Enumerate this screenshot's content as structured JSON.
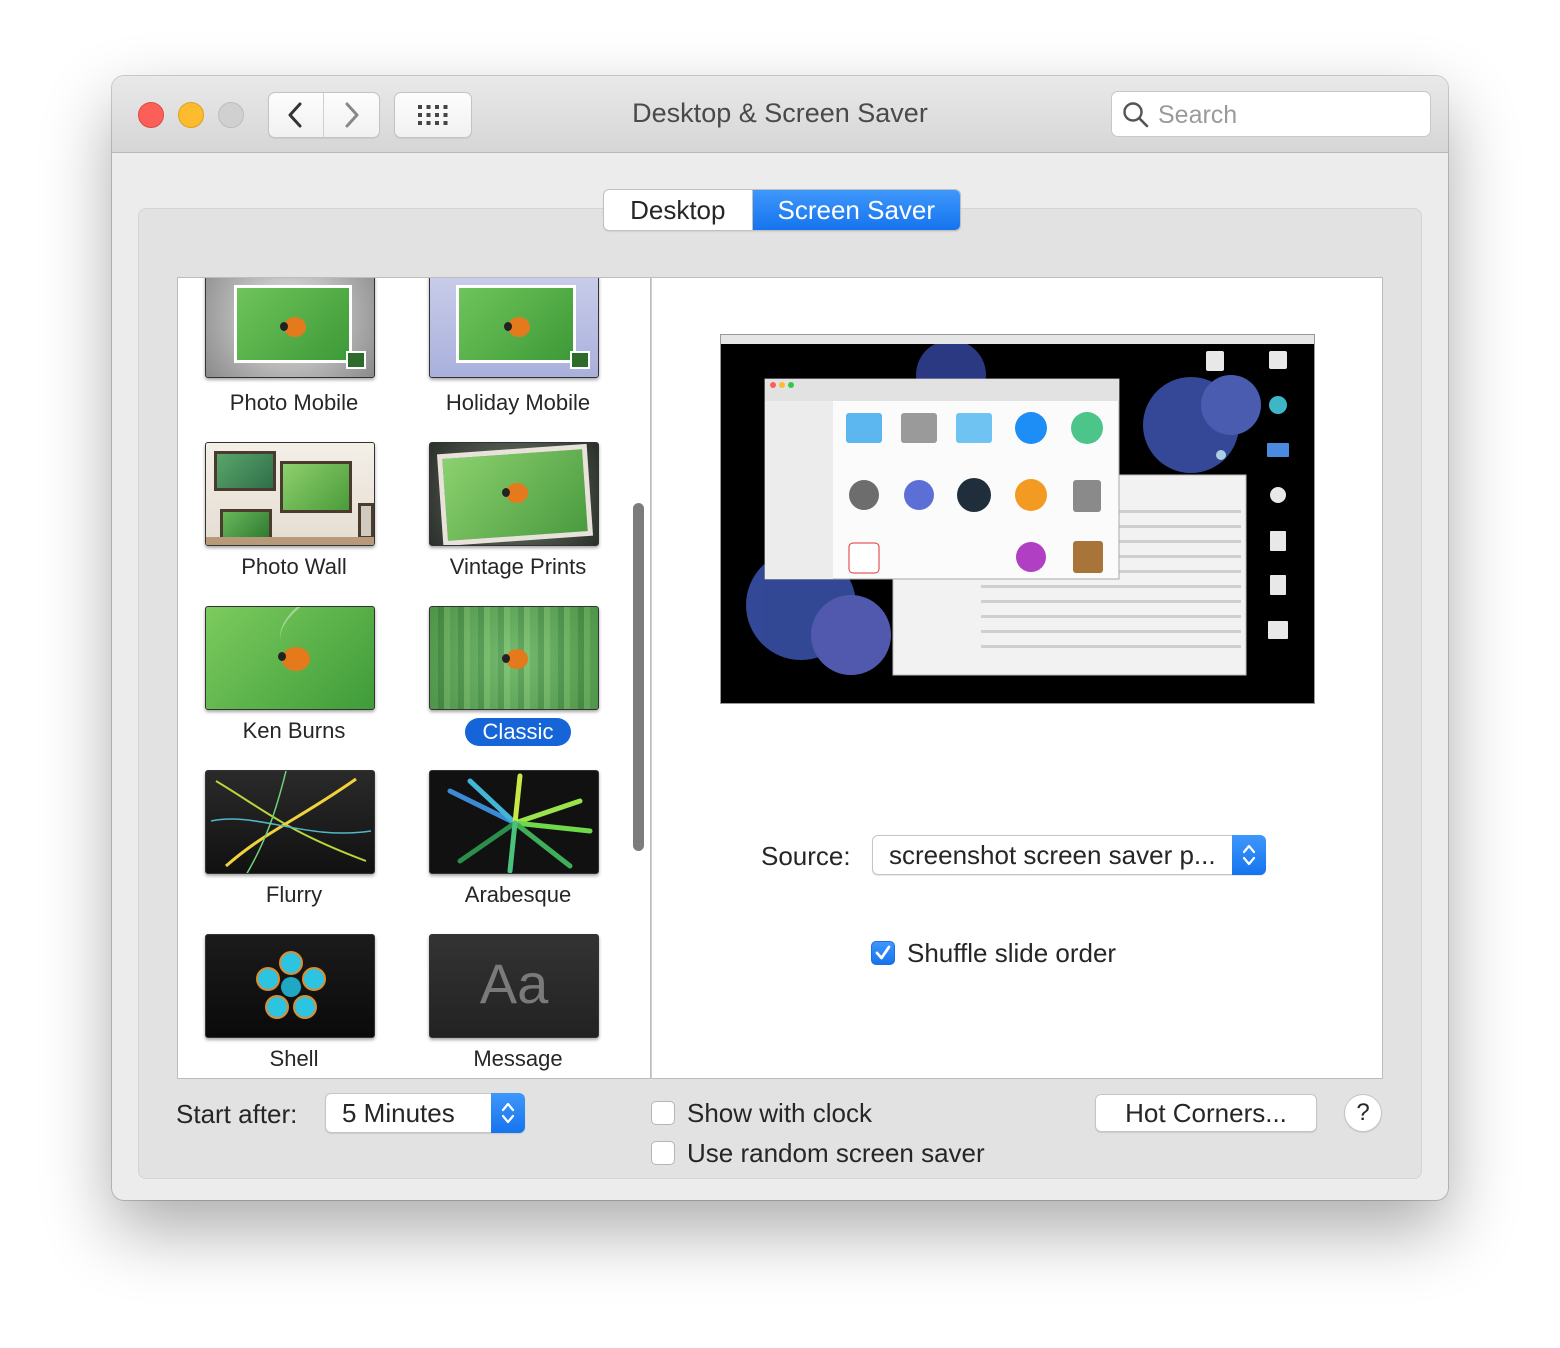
{
  "window": {
    "title": "Desktop & Screen Saver",
    "search_placeholder": "Search"
  },
  "tabs": [
    {
      "label": "Desktop",
      "selected": false
    },
    {
      "label": "Screen Saver",
      "selected": true
    }
  ],
  "screen_savers": [
    {
      "label": "Photo Mobile"
    },
    {
      "label": "Holiday Mobile"
    },
    {
      "label": "Photo Wall"
    },
    {
      "label": "Vintage Prints"
    },
    {
      "label": "Ken Burns"
    },
    {
      "label": "Classic",
      "selected": true
    },
    {
      "label": "Flurry"
    },
    {
      "label": "Arabesque"
    },
    {
      "label": "Shell"
    },
    {
      "label": "Message",
      "thumb_text": "Aa"
    }
  ],
  "preview": {
    "source_label": "Source:",
    "source_value": "screenshot screen saver p...",
    "shuffle_label": "Shuffle slide order",
    "shuffle_checked": true
  },
  "bottom": {
    "start_after_label": "Start after:",
    "start_after_value": "5 Minutes",
    "show_clock_label": "Show with clock",
    "show_clock_checked": false,
    "random_label": "Use random screen saver",
    "random_checked": false,
    "hot_corners_label": "Hot Corners...",
    "help_label": "?"
  },
  "colors": {
    "accent": "#1574ee",
    "selection": "#1565d8"
  }
}
